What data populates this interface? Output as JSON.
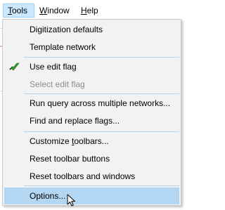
{
  "menubar": {
    "items": [
      {
        "label_before": "",
        "mnemonic": "T",
        "label_after": "ools"
      },
      {
        "label_before": "",
        "mnemonic": "W",
        "label_after": "indow"
      },
      {
        "label_before": "",
        "mnemonic": "H",
        "label_after": "elp"
      }
    ]
  },
  "menu": {
    "items": [
      {
        "label": "Digitization defaults",
        "enabled": true
      },
      {
        "label": "Template network",
        "enabled": true
      },
      {
        "label": "Use edit flag",
        "enabled": true,
        "icon": "green-flag-check-icon"
      },
      {
        "label": "Select edit flag",
        "enabled": false
      },
      {
        "label": "Run query across multiple networks...",
        "enabled": true
      },
      {
        "label": "Find and replace flags...",
        "enabled": true
      },
      {
        "label_before": "Customize ",
        "mnemonic": "t",
        "label_after": "oolbars...",
        "enabled": true
      },
      {
        "label": "Reset toolbar buttons",
        "enabled": true
      },
      {
        "label": "Reset toolbars and windows",
        "enabled": true
      },
      {
        "label": "Options...",
        "enabled": true,
        "hovered": true
      }
    ]
  },
  "colors": {
    "menu_bg": "#f2f2f2",
    "hover_bg": "#b3d7f3",
    "open_menubar_bg": "#cce8ff",
    "separator": "#b8d4ea",
    "disabled_text": "#8d8d8d"
  }
}
